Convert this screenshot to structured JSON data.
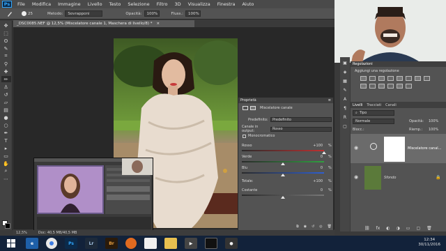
{
  "menubar": {
    "logo": "Ps",
    "items": [
      "File",
      "Modifica",
      "Immagine",
      "Livello",
      "Testo",
      "Selezione",
      "Filtro",
      "3D",
      "Visualizza",
      "Finestra",
      "Aiuto"
    ]
  },
  "options_bar": {
    "brush_size": "25",
    "mode_label": "Metodo:",
    "mode_value": "Sovrapponi",
    "opacity_label": "Opacità:",
    "opacity_value": "100%",
    "flow_label": "Fluss.:",
    "flow_value": "100%"
  },
  "document": {
    "tab_title": "_DSC0085.NEF @ 12,5% (Miscelatore canale 1, Maschera di livello/8) *",
    "zoom": "12,5%",
    "doc_info": "Doc: 40,5 MB/40,5 MB"
  },
  "properties": {
    "title": "Proprietà",
    "adjustment_name": "Miscelatore canale",
    "preset_label": "Predefinito:",
    "preset_value": "Predefinito",
    "output_label": "Canale in output:",
    "output_value": "Rosso",
    "monochrome_label": "Monocromatico",
    "sliders": [
      {
        "label": "Rosso",
        "value": "+100",
        "unit": "%",
        "color": "#c03030",
        "pos": 1.0
      },
      {
        "label": "Verde",
        "value": "0",
        "unit": "%",
        "color": "#30a040",
        "pos": 0.5
      },
      {
        "label": "Blu",
        "value": "0",
        "unit": "%",
        "color": "#2f5fd0",
        "pos": 0.5
      },
      {
        "label": "Totale:",
        "value": "+100",
        "unit": "%",
        "color": "#888888",
        "pos": 0.75
      },
      {
        "label": "Costante",
        "value": "0",
        "unit": "%",
        "color": "#777777",
        "pos": 0.5
      }
    ]
  },
  "adjustments_panel": {
    "title": "Regolazioni",
    "subtitle": "Aggiungi una regolazione"
  },
  "layers_panel": {
    "tabs": [
      "Livelli",
      "Tracciati",
      "Canali"
    ],
    "filter_value": "Tipo",
    "blend_mode": "Normale",
    "opacity_label": "Opacità:",
    "opacity_value": "100%",
    "lock_label": "Blocc.:",
    "fill_label": "Riemp.:",
    "fill_value": "100%",
    "layers": [
      {
        "name": "Miscelatore canal..."
      },
      {
        "name": "Sfondo"
      }
    ]
  },
  "status": {
    "zoom": "12,5%",
    "info": "Doc: 40,5 MB/40,5 MB"
  },
  "taskbar": {
    "apps": [
      "Explorer",
      "Chrome",
      "Ps",
      "Lr",
      "Br",
      "Firefox",
      "Paint",
      "Folder",
      "Media",
      "Terminal",
      "Camera"
    ],
    "time": "12:34",
    "date": "30/11/2016"
  },
  "colors": {
    "ps_blue": "#31a8ff",
    "panel_bg": "#535353",
    "canvas_bg": "#282828",
    "taskbar": "#12223a"
  }
}
